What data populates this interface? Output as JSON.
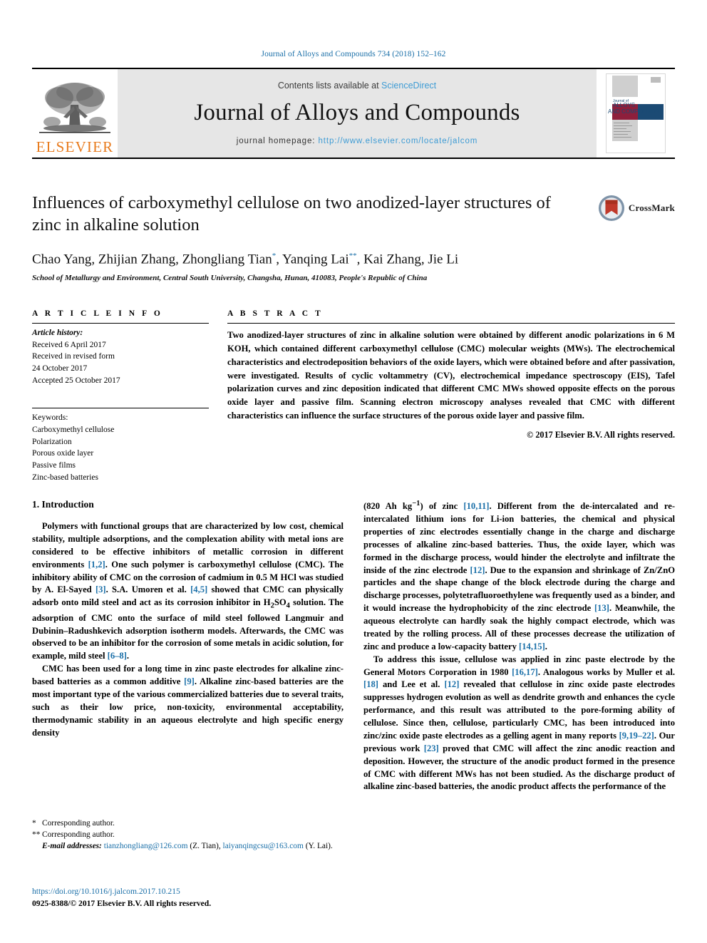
{
  "running_head": "Journal of Alloys and Compounds 734 (2018) 152–162",
  "masthead": {
    "publisher_name": "ELSEVIER",
    "contents_prefix": "Contents lists available at ",
    "contents_link": "ScienceDirect",
    "journal_title": "Journal of Alloys and Compounds",
    "homepage_label": "journal homepage: ",
    "homepage_url": "http://www.elsevier.com/locate/jalcom",
    "cover_title_line1": "Journal of",
    "cover_title_line2": "ALLOYS",
    "cover_title_line3": "AND COMPOUNDS"
  },
  "crossmark": {
    "label": "CrossMark"
  },
  "article": {
    "title": "Influences of carboxymethyl cellulose on two anodized-layer structures of zinc in alkaline solution",
    "authors_parts": [
      {
        "text": "Chao Yang, Zhijian Zhang, Zhongliang Tian"
      },
      {
        "sup": "*"
      },
      {
        "text": ", Yanqing Lai"
      },
      {
        "sup": "**"
      },
      {
        "text": ", Kai Zhang, Jie Li"
      }
    ],
    "affiliation": "School of Metallurgy and Environment, Central South University, Changsha, Hunan, 410083, People's Republic of China"
  },
  "article_info": {
    "heading": "A R T I C L E  I N F O",
    "history_label": "Article history:",
    "history_lines": [
      "Received 6 April 2017",
      "Received in revised form",
      "24 October 2017",
      "Accepted 25 October 2017"
    ],
    "keywords_label": "Keywords:",
    "keywords": [
      "Carboxymethyl cellulose",
      "Polarization",
      "Porous oxide layer",
      "Passive films",
      "Zinc-based batteries"
    ]
  },
  "abstract": {
    "heading": "A B S T R A C T",
    "text": "Two anodized-layer structures of zinc in alkaline solution were obtained by different anodic polarizations in 6 M KOH, which contained different carboxymethyl cellulose (CMC) molecular weights (MWs). The electrochemical characteristics and electrodeposition behaviors of the oxide layers, which were obtained before and after passivation, were investigated. Results of cyclic voltammetry (CV), electrochemical impedance spectroscopy (EIS), Tafel polarization curves and zinc deposition indicated that different CMC MWs showed opposite effects on the porous oxide layer and passive film. Scanning electron microscopy analyses revealed that CMC with different characteristics can influence the surface structures of the porous oxide layer and passive film.",
    "copyright": "© 2017 Elsevier B.V. All rights reserved."
  },
  "body": {
    "section_title": "1. Introduction",
    "left_paragraphs": [
      "Polymers with functional groups that are characterized by low cost, chemical stability, multiple adsorptions, and the complexation ability with metal ions are considered to be effective inhibitors of metallic corrosion in different environments [1,2]. One such polymer is carboxymethyl cellulose (CMC). The inhibitory ability of CMC on the corrosion of cadmium in 0.5 M HCl was studied by A. El-Sayed [3]. S.A. Umoren et al. [4,5] showed that CMC can physically adsorb onto mild steel and act as its corrosion inhibitor in H2SO4 solution. The adsorption of CMC onto the surface of mild steel followed Langmuir and Dubinin–Radushkevich adsorption isotherm models. Afterwards, the CMC was observed to be an inhibitor for the corrosion of some metals in acidic solution, for example, mild steel [6–8].",
      "CMC has been used for a long time in zinc paste electrodes for alkaline zinc-based batteries as a common additive [9]. Alkaline zinc-based batteries are the most important type of the various commercialized batteries due to several traits, such as their low price, non-toxicity, environmental acceptability, thermodynamic stability in an aqueous electrolyte and high specific energy density"
    ],
    "right_paragraphs": [
      "(820 Ah kg-1) of zinc [10,11]. Different from the de-intercalated and re-intercalated lithium ions for Li-ion batteries, the chemical and physical properties of zinc electrodes essentially change in the charge and discharge processes of alkaline zinc-based batteries. Thus, the oxide layer, which was formed in the discharge process, would hinder the electrolyte and infiltrate the inside of the zinc electrode [12]. Due to the expansion and shrinkage of Zn/ZnO particles and the shape change of the block electrode during the charge and discharge processes, polytetrafluoroethylene was frequently used as a binder, and it would increase the hydrophobicity of the zinc electrode [13]. Meanwhile, the aqueous electrolyte can hardly soak the highly compact electrode, which was treated by the rolling process. All of these processes decrease the utilization of zinc and produce a low-capacity battery [14,15].",
      "To address this issue, cellulose was applied in zinc paste electrode by the General Motors Corporation in 1980 [16,17]. Analogous works by Muller et al. [18] and Lee et al. [12] revealed that cellulose in zinc oxide paste electrodes suppresses hydrogen evolution as well as dendrite growth and enhances the cycle performance, and this result was attributed to the pore-forming ability of cellulose. Since then, cellulose, particularly CMC, has been introduced into zinc/zinc oxide paste electrodes as a gelling agent in many reports [9,19–22]. Our previous work [23] proved that CMC will affect the zinc anodic reaction and deposition. However, the structure of the anodic product formed in the presence of CMC with different MWs has not been studied. As the discharge product of alkaline zinc-based batteries, the anodic product affects the performance of the"
    ]
  },
  "footnotes": {
    "line1_mark": "*",
    "line1_text": "Corresponding author.",
    "line2_mark": "**",
    "line2_text": "Corresponding author.",
    "email_label": "E-mail addresses:",
    "email1": "tianzhongliang@126.com",
    "email1_owner": "(Z. Tian),",
    "email2": "laiyanqingcsu@163.com",
    "email2_owner": "(Y. Lai)."
  },
  "doi_block": {
    "doi": "https://doi.org/10.1016/j.jalcom.2017.10.215",
    "issn_line": "0925-8388/© 2017 Elsevier B.V. All rights reserved."
  },
  "colors": {
    "link_blue": "#1a6fa8",
    "sciencedirect_blue": "#3d9bd4",
    "elsevier_orange": "#E87B1E",
    "masthead_gray": "#e6e6e6",
    "cover_red": "#8e1f3c",
    "cover_navy": "#1b4a74"
  }
}
